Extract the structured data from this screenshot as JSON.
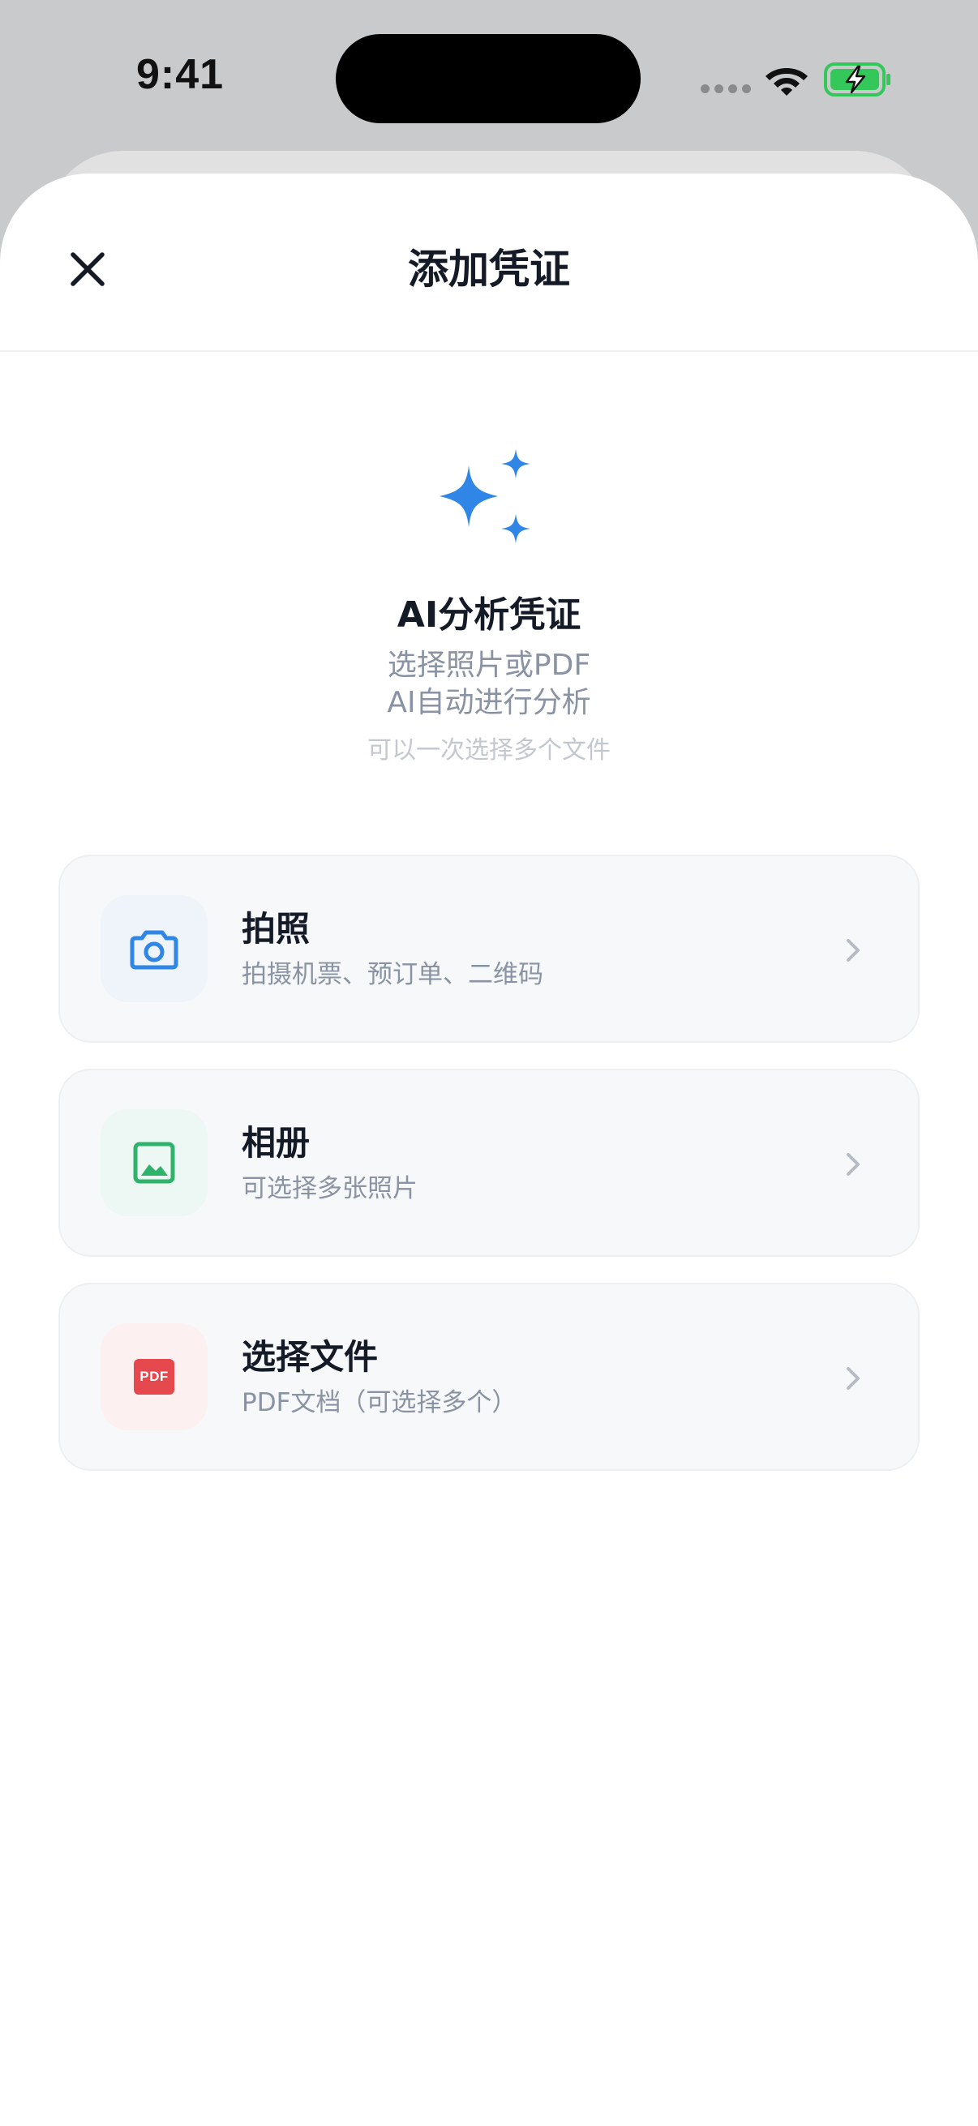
{
  "status_bar": {
    "time": "9:41",
    "battery_color": "#34c759"
  },
  "sheet": {
    "title": "添加凭证",
    "close_icon": "close-icon"
  },
  "hero": {
    "icon": "sparkles-icon",
    "title": "AI分析凭证",
    "subtitle_line1": "选择照片或PDF",
    "subtitle_line2": "AI自动进行分析",
    "hint": "可以一次选择多个文件"
  },
  "options": [
    {
      "title": "拍照",
      "subtitle": "拍摄机票、预订单、二维码",
      "icon": "camera-icon",
      "icon_color": "#2f86e6",
      "icon_bg": "#eef4f9"
    },
    {
      "title": "相册",
      "subtitle": "可选择多张照片",
      "icon": "image-icon",
      "icon_color": "#2fb26a",
      "icon_bg": "#edf7f4"
    },
    {
      "title": "选择文件",
      "subtitle": "PDF文档（可选择多个）",
      "icon": "pdf-icon",
      "icon_label": "PDF",
      "icon_color": "#e5484d",
      "icon_bg": "#fdf0f0"
    }
  ],
  "colors": {
    "accent": "#2f86e6",
    "title_text": "#141a26",
    "secondary_text": "#8a93a3",
    "hint_text": "#c3c8d0",
    "card_bg": "#f7f8fa"
  }
}
